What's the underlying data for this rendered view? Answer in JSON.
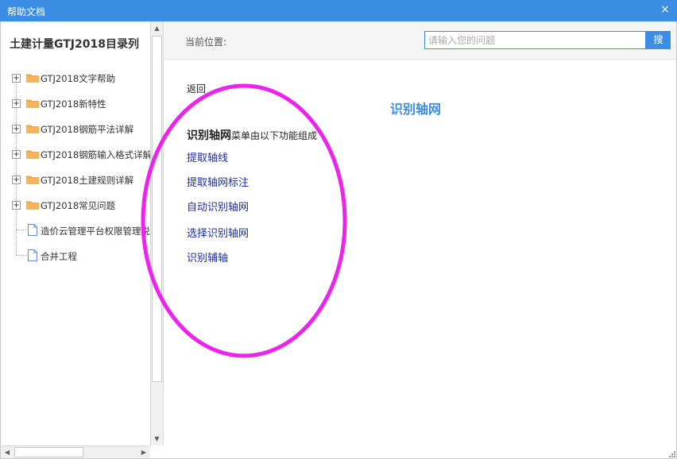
{
  "window": {
    "title": "帮助文档",
    "close_symbol": "×"
  },
  "tree": {
    "title": "土建计量GTJ2018目录列",
    "items": [
      {
        "label": "GTJ2018文字帮助",
        "kind": "folder",
        "expander": "+"
      },
      {
        "label": "GTJ2018新特性",
        "kind": "folder",
        "expander": "+"
      },
      {
        "label": "GTJ2018钢筋平法详解",
        "kind": "folder",
        "expander": "+"
      },
      {
        "label": "GTJ2018钢筋输入格式详解",
        "kind": "folder",
        "expander": "+"
      },
      {
        "label": "GTJ2018土建规则详解",
        "kind": "folder",
        "expander": "+"
      },
      {
        "label": "GTJ2018常见问题",
        "kind": "folder",
        "expander": "+"
      },
      {
        "label": "造价云管理平台权限管理说明",
        "kind": "document"
      },
      {
        "label": "合并工程",
        "kind": "document"
      }
    ]
  },
  "header": {
    "breadcrumb_label": "当前位置:",
    "search_placeholder": "请输入您的问题",
    "search_button": "搜"
  },
  "content": {
    "back_label": "返回",
    "title": "识别轴网",
    "intro_bold": "识别轴网",
    "intro_rest": "菜单由以下功能组成",
    "functions": [
      "提取轴线",
      "提取轴网标注",
      "自动识别轴网",
      "选择识别轴网",
      "识别辅轴"
    ]
  },
  "colors": {
    "titlebar": "#3c8de4",
    "accent": "#3c8de4",
    "link": "#1a2d9c",
    "folder": "#f5a742",
    "annotation": "#ee22ee"
  },
  "icons": {
    "expander": "plus-box-icon",
    "folder": "folder-icon",
    "document": "document-icon",
    "close": "close-icon",
    "resize": "resize-grip-icon"
  }
}
